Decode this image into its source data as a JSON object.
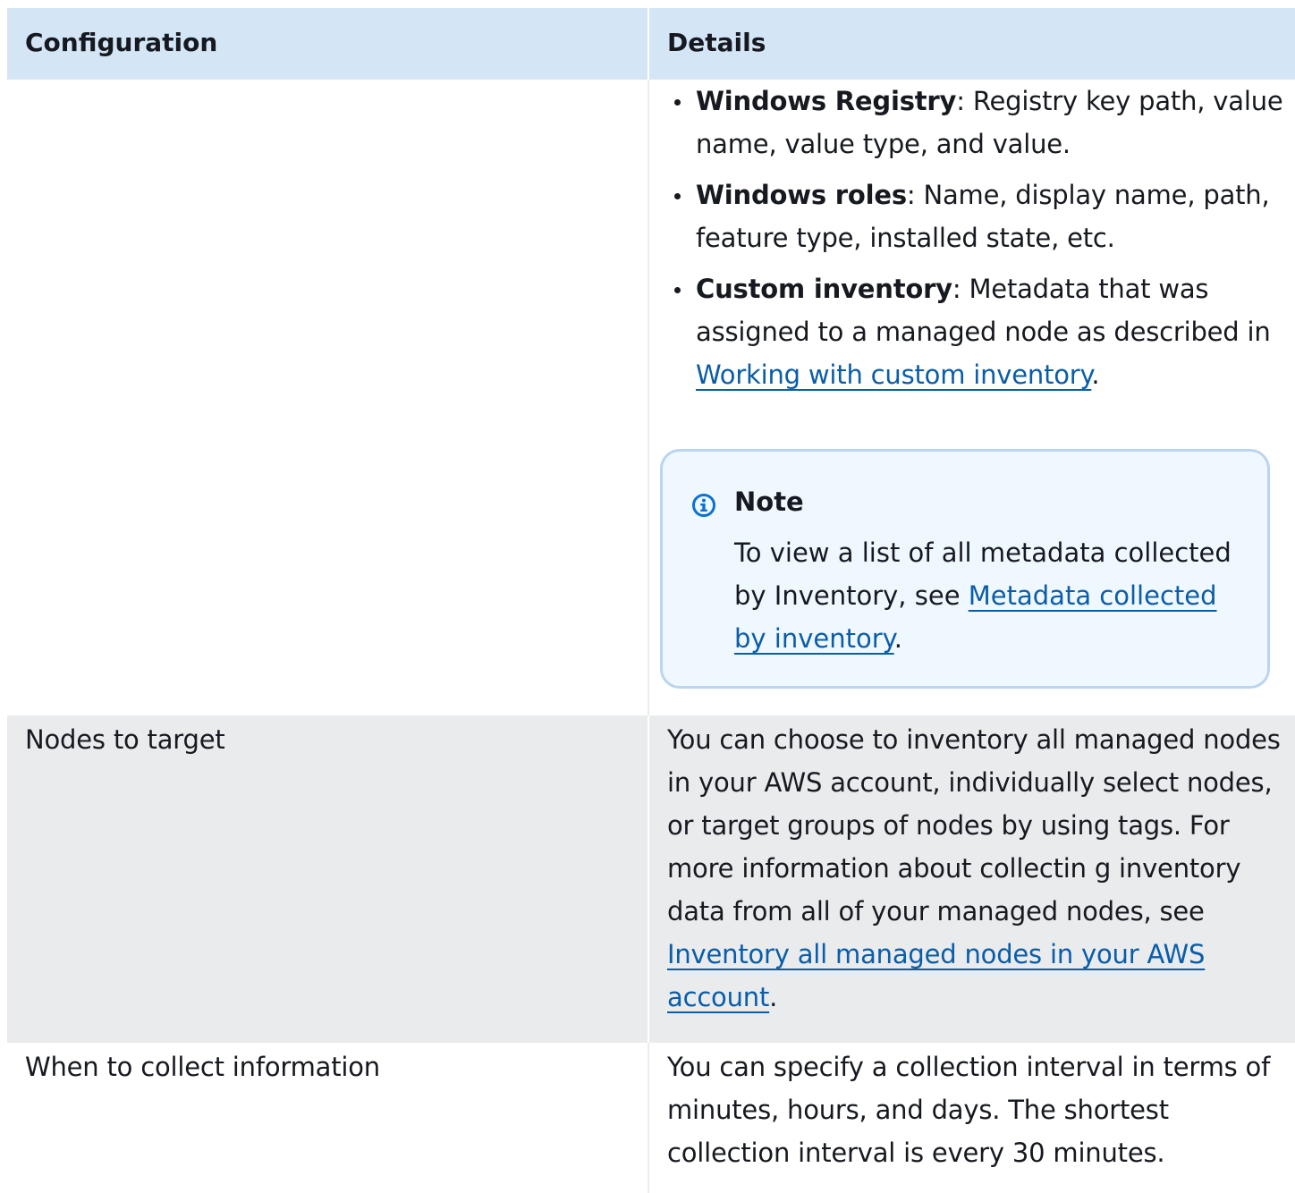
{
  "table": {
    "headers": {
      "configuration": "Configuration",
      "details": "Details"
    },
    "row_metadata": {
      "bullets": [
        {
          "term": "Windows Registry",
          "text": ": Registry key path, value name, value type, and value."
        },
        {
          "term": "Windows roles",
          "text": ": Name, display name, path, feature type, installed state, etc."
        },
        {
          "term": "Custom inventory",
          "text": ": Metadata that was assigned to a managed node as described in ",
          "link": "Working with custom inventory",
          "after": "."
        }
      ],
      "note": {
        "title": "Note",
        "text": "To view a list of all metadata collected by Inventory, see ",
        "link": "Metadata collected by inventory",
        "after": "."
      }
    },
    "row_nodes": {
      "label": "Nodes to target",
      "text": "You can choose to inventory all managed nodes in your AWS account, individually select nodes, or target groups of nodes by using tags. For more information about collectin g inventory data from all of your managed nodes, see ",
      "link": "Inventory all managed nodes in your AWS account",
      "after": "."
    },
    "row_when": {
      "label": "When to collect information",
      "text": "You can specify a collection interval in terms of minutes, hours, and days. The shortest collection interval is every 30 minutes."
    }
  },
  "colors": {
    "header_bg": "#d4e6f6",
    "stripe_bg": "#e9ebed",
    "note_bg": "#f0f8ff",
    "note_border": "#b9d5ef",
    "link": "#0a5da8",
    "info_icon": "#0972d3"
  },
  "icons": {
    "note": "info-icon"
  }
}
